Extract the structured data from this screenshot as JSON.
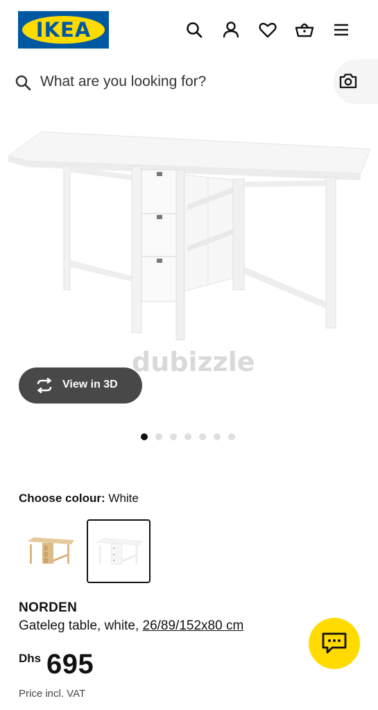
{
  "header": {
    "logo_text": "IKEA",
    "icons": [
      "search-icon",
      "user-icon",
      "heart-icon",
      "basket-icon",
      "menu-icon"
    ]
  },
  "search": {
    "placeholder": "What are you looking for?"
  },
  "gallery": {
    "watermark": "dubizzle",
    "view3d_label": "View in 3D",
    "slide_count": 7,
    "active_slide": 1
  },
  "colour": {
    "label": "Choose colour:",
    "value": "White",
    "options": [
      "birch",
      "white"
    ],
    "selected": "white"
  },
  "product": {
    "name": "NORDEN",
    "desc_prefix": "Gateleg table, white, ",
    "dimensions": "26/89/152x80 cm",
    "currency": "Dhs",
    "price": "695",
    "vat_note": "Price incl. VAT"
  },
  "colors": {
    "brand_blue": "#0058a3",
    "brand_yellow": "#ffdb00",
    "button_dark": "#484848"
  }
}
